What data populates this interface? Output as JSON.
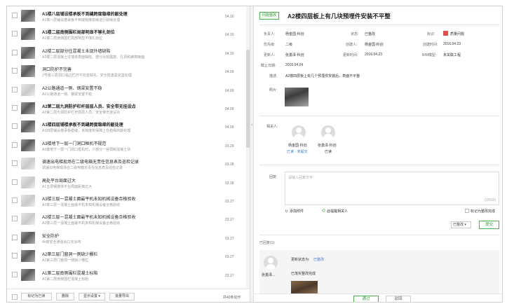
{
  "list": {
    "items": [
      {
        "title": "A1楼八层铺设楼承板不到缝跨度稳缘的敲处理",
        "desc": "A1楼八层铺设楼承板不到缝跨度稳缘进行取缘处理",
        "date": "04.10",
        "bold": true,
        "thumb": "dark"
      },
      {
        "title": "A1楼二层南侧围栏局部明显不够扎剑位",
        "desc": "A1楼二层南侧围栏局部明显不够扎剑位",
        "date": "04.10",
        "bold": true,
        "thumb": "dark"
      },
      {
        "title": "A2楼二层部分往混凝土未现外墙缺陷",
        "desc": "A2楼二层混凝土往墙体表面缺陷、部分出现露筋、孔洞和蜂窝麻面",
        "date": "04.10",
        "bold": false,
        "thumb": "dark"
      },
      {
        "title": "洞口防护不完善",
        "desc": "2号楼三层洞口临边栏杆不完善缺失，安全隐患需完善处理",
        "date": "04.09",
        "bold": false,
        "thumb": "dark"
      },
      {
        "title": "A2公路通道一侧、钢梁安置不稳",
        "desc": "A2公路通道一侧、钢梁安置不稳",
        "date": "04.09",
        "bold": false,
        "thumb": "light"
      },
      {
        "title": "A2第二层九洞防护栏杆层层人员、安全带无挂设点",
        "desc": "A2第二层九洞防护栏杆层层人员，安全带无挂设点",
        "date": "04.09",
        "bold": true,
        "thumb": "dark"
      },
      {
        "title": "A1楼四层铺楼承板不到缝跨度稳缘的敲处理",
        "desc": "A1四层铺设楼承板稳缝，未跨度到保障上在稳缘的敲处理",
        "date": "04.09",
        "bold": true,
        "thumb": "dark"
      },
      {
        "title": "A3楼地下一层一门洞口框机不规范",
        "desc": "A3楼地下一层一门洞口框机时，少部分一些预制混凝土块",
        "date": "03.29",
        "bold": false,
        "thumb": "dark"
      },
      {
        "title": "调速出电梯现场在二级电箱无责任信息表及巡检记录",
        "desc": "调速出电梯现场在二级电箱无责任信息表及巡检记录",
        "date": "03.28",
        "bold": false,
        "thumb": "light"
      },
      {
        "title": "高处平台局面过大",
        "desc": "A1五层钢楼体平台局面距离过大",
        "date": "03.28",
        "bold": false,
        "thumb": "light"
      },
      {
        "title": "A3楼三层一混凝土面最平机未知机械设备合格验收",
        "desc": "A3楼三层一混凝土面最平机未知机械设备合格验收",
        "date": "03.27",
        "bold": false,
        "thumb": "light"
      },
      {
        "title": "A2楼三层一混凝土面最平机未知机械设备合格验收",
        "desc": "A2楼三层一混凝土面最平机未知机械设备合格验收",
        "date": "03.27",
        "bold": false,
        "thumb": "light"
      },
      {
        "title": "安全防护",
        "desc": "4#楼安全通道出口无涂布",
        "date": "03.27",
        "bold": false,
        "thumb": "dark"
      },
      {
        "title": "A2第三层门窗洞一侧缺少栅栏",
        "desc": "A2第三层门窗洞一侧缺少栅栏",
        "date": "03.27",
        "bold": false,
        "thumb": "dark"
      },
      {
        "title": "A1第二层南侧围栏混凝土标陷",
        "desc": "A1第二层南侧围栏混凝土标陷",
        "date": "03.27",
        "bold": false,
        "thumb": "dark"
      }
    ]
  },
  "footer": {
    "btn_mark": "标记为已读",
    "btn_delete": "删除",
    "btn_display": "显示设置 ▾",
    "btn_export": "批量导出",
    "total": "共40条动作"
  },
  "detail": {
    "status_tag": "问题整改",
    "title": "A2楼四层板上有几块预埋件安装不平整",
    "fields": {
      "owner_label": "负责人:",
      "owner_value": "杨金国·科创",
      "status_label": "状态:",
      "status_value": "已整改",
      "tag_label": "标识:",
      "tag_value": "质量问题",
      "level_label": "优先级:",
      "level_value": "二级",
      "creator_label": "创建人:",
      "creator_value": "杨金国·科创",
      "create_time_label": "创建时间:",
      "create_time_value": "2016.04.23",
      "updater_label": "更新人:",
      "updater_value": "张勇泽·科创",
      "update_time_label": "更新时间:",
      "update_time_value": "2016.04.23",
      "bim_label": "BIM模型:",
      "bim_value": "未关联工程",
      "deadline_label": "截止日期:",
      "deadline_value": "2016.04.24",
      "desc_label": "描述:",
      "desc_value": "A2楼四层板上有几个预埋件安装后，表面不平整",
      "photo_label": "照片:",
      "related_label": "相关人:"
    },
    "people": [
      {
        "name": "杨金国·科创",
        "state": "已读 · 未提交"
      },
      {
        "name": "张勇泽·科创",
        "state": "已读"
      }
    ],
    "reply": {
      "label": "回复:",
      "placeholder": "请输入回复文字",
      "count": "(0/500)",
      "attach": "添加附件",
      "remind": "@提醒相关人",
      "mark_done": "标记为整改完成",
      "status_select": "已整改 ▾",
      "submit": "提交"
    },
    "replies_label": "已回复(1):",
    "reply_item": {
      "author": "张勇泽...",
      "update_line": "更新状态为:",
      "update_status": "已整改",
      "content": "已落实整改完成"
    },
    "actions": {
      "pass": "通过",
      "reject": "驳回"
    }
  }
}
